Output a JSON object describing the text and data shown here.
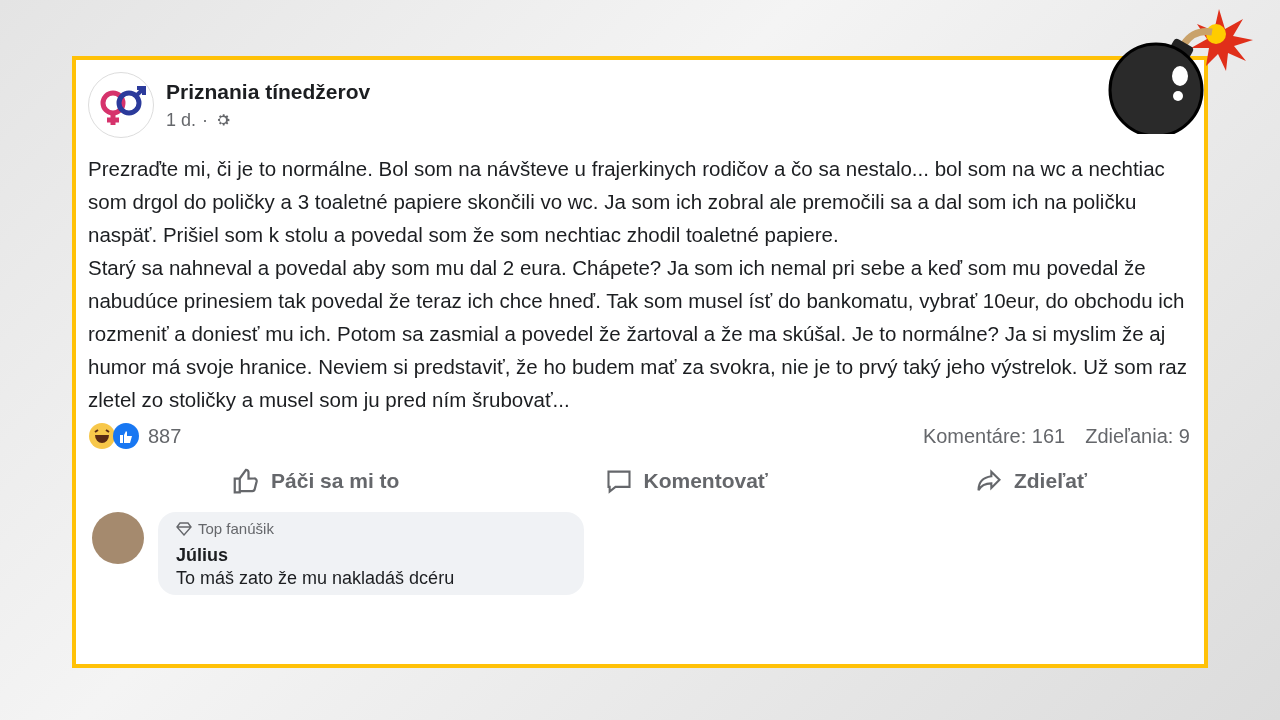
{
  "post": {
    "page_name": "Priznania tínedžerov",
    "time": "1 d.",
    "separator": "·",
    "paragraphs": [
      "Prezraďte mi, či je to normálne. Bol som na návšteve u frajerkinych rodičov a čo sa nestalo... bol som na wc a nechtiac som drgol do poličky a 3 toaletné papiere skončili vo wc. Ja som ich zobral ale premočili sa a dal som ich na poličku naspäť. Prišiel som k stolu a povedal som že som nechtiac zhodil toaletné papiere.",
      "Starý sa nahneval a povedal aby som mu dal 2 eura. Chápete? Ja som ich nemal pri sebe a keď som mu povedal že nabudúce prinesiem tak povedal že teraz ich chce hneď. Tak som musel ísť do bankomatu, vybrať 10eur, do obchodu ich rozmeniť a doniesť mu ich. Potom sa zasmial a povedel že žartoval a že ma skúšal. Je to normálne? Ja si myslim že aj humor má svoje hranice. Neviem si predstaviť, že ho budem mať za svokra, nie je to prvý taký jeho výstrelok. Už som raz zletel zo stoličky a musel som ju pred ním šrubovať..."
    ],
    "reactions_count": "887",
    "comments_count": "Komentáre: 161",
    "shares_count": "Zdieľania: 9",
    "actions": [
      {
        "kind": "like",
        "label": "Páči sa mi to"
      },
      {
        "kind": "comment",
        "label": "Komentovať"
      },
      {
        "kind": "share",
        "label": "Zdieľať"
      }
    ]
  },
  "comment": {
    "badge": "Top fanúšik",
    "author": "Július",
    "text": "To máš zato že mu nakladáš dcéru"
  }
}
